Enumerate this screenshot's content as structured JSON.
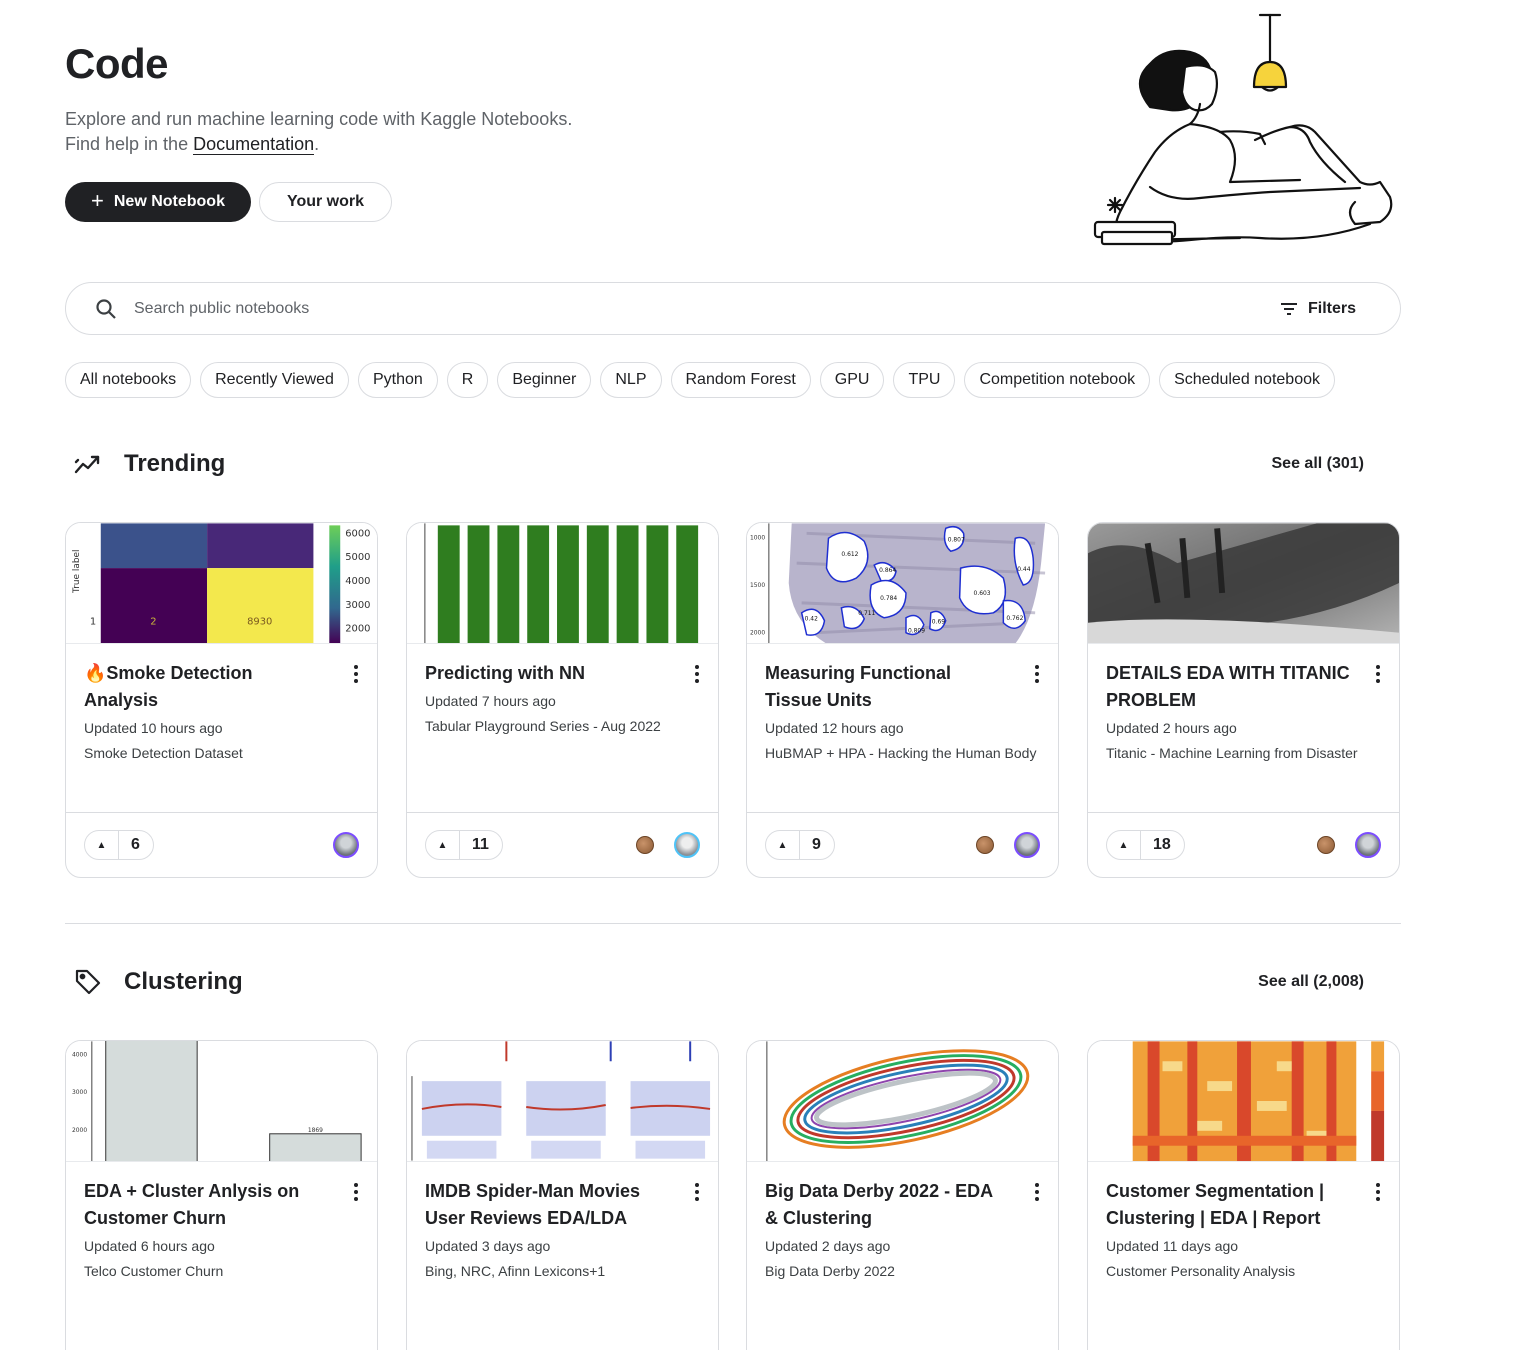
{
  "header": {
    "title": "Code",
    "subtitle_line1": "Explore and run machine learning code with Kaggle Notebooks.",
    "subtitle_line2_prefix": "Find help in the ",
    "subtitle_link": "Documentation",
    "subtitle_line2_suffix": ".",
    "new_notebook_label": "New Notebook",
    "your_work_label": "Your work"
  },
  "search": {
    "placeholder": "Search public notebooks",
    "filters_label": "Filters"
  },
  "chips": [
    "All notebooks",
    "Recently Viewed",
    "Python",
    "R",
    "Beginner",
    "NLP",
    "Random Forest",
    "GPU",
    "TPU",
    "Competition notebook",
    "Scheduled notebook"
  ],
  "trending": {
    "title": "Trending",
    "see_all": "See all (301)",
    "cards": [
      {
        "title": "🔥Smoke Detection Analysis",
        "updated": "Updated 10 hours ago",
        "dataset": "Smoke Detection Dataset",
        "votes": "6"
      },
      {
        "title": "Predicting with NN",
        "updated": "Updated 7 hours ago",
        "dataset": "Tabular Playground Series - Aug 2022",
        "votes": "11"
      },
      {
        "title": "Measuring Functional Tissue Units",
        "updated": "Updated 12 hours ago",
        "dataset": "HuBMAP + HPA - Hacking the Human Body",
        "votes": "9"
      },
      {
        "title": "DETAILS EDA WITH TITANIC PROBLEM",
        "updated": "Updated 2 hours ago",
        "dataset": "Titanic - Machine Learning from Disaster",
        "votes": "18"
      }
    ]
  },
  "clustering": {
    "title": "Clustering",
    "see_all": "See all (2,008)",
    "cards": [
      {
        "title": "EDA + Cluster Anlysis on Customer Churn",
        "updated": "Updated 6 hours ago",
        "dataset": "Telco Customer Churn"
      },
      {
        "title": "IMDB Spider-Man Movies User Reviews EDA/LDA",
        "updated": "Updated 3 days ago",
        "dataset": "Bing, NRC, Afinn Lexicons+1"
      },
      {
        "title": "Big Data Derby 2022 - EDA & Clustering",
        "updated": "Updated 2 days ago",
        "dataset": "Big Data Derby 2022"
      },
      {
        "title": "Customer Segmentation | Clustering | EDA | Report",
        "updated": "Updated 11 days ago",
        "dataset": "Customer Personality Analysis"
      }
    ]
  },
  "thumbnails": {
    "confusion": {
      "ylabel": "True label",
      "row_label": "1",
      "cell_a": "2",
      "cell_b": "8930",
      "colorbar": [
        "6000",
        "5000",
        "4000",
        "3000",
        "2000"
      ]
    },
    "tissue": {
      "yticks": [
        "1000",
        "1500",
        "2000"
      ],
      "labels": [
        "0.612",
        "0.864",
        "0.784",
        "0.711",
        "0.603",
        "0.44",
        "0.809",
        "0.69",
        "0.762",
        "0.807",
        "0.42"
      ]
    },
    "bars": {
      "yticks": [
        "4000",
        "3000",
        "2000"
      ],
      "bar_label": "1869"
    }
  },
  "colors": {
    "primary": "#202124",
    "border": "#dadce0",
    "muted": "#5f6368",
    "accent_purple": "#7c4dff"
  }
}
